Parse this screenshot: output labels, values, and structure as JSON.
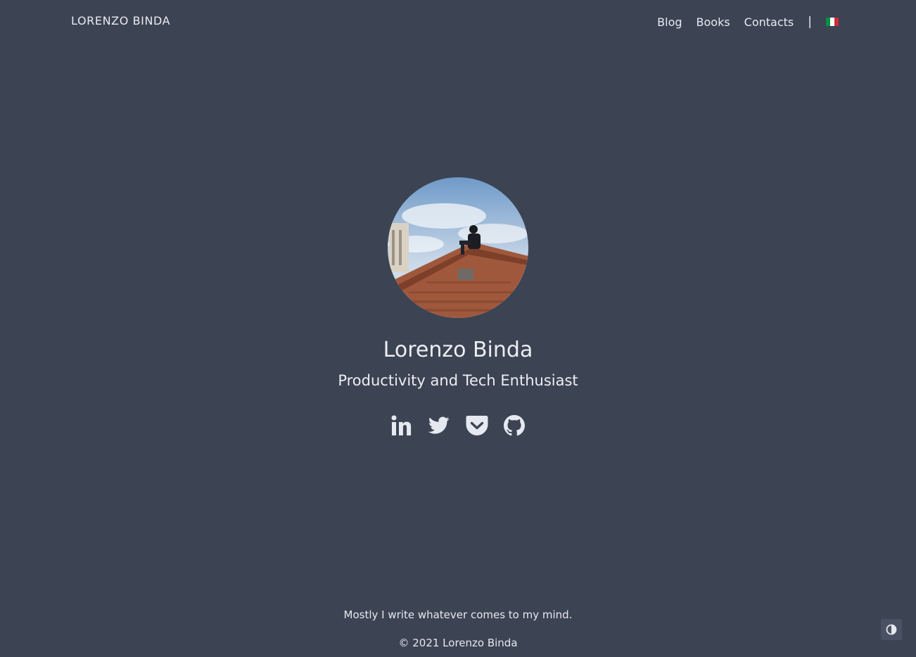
{
  "header": {
    "brand": "LORENZO BINDA",
    "nav": [
      {
        "label": "Blog"
      },
      {
        "label": "Books"
      },
      {
        "label": "Contacts"
      }
    ],
    "separator": "|",
    "language_flag": "italian-flag-icon",
    "flag_colors": [
      "#009246",
      "#ffffff",
      "#ce2b37"
    ]
  },
  "hero": {
    "avatar": "profile-photo",
    "name": "Lorenzo Binda",
    "tagline": "Productivity and Tech Enthusiast",
    "socials": [
      {
        "icon": "linkedin-icon"
      },
      {
        "icon": "twitter-icon"
      },
      {
        "icon": "pocket-icon"
      },
      {
        "icon": "github-icon"
      }
    ]
  },
  "footer": {
    "motto": "Mostly I write whatever comes to my mind.",
    "copyright": "© 2021 Lorenzo Binda"
  },
  "theme_toggle": {
    "icon": "contrast-icon"
  },
  "colors": {
    "background": "#3c4353",
    "text": "#e8ebf1"
  }
}
